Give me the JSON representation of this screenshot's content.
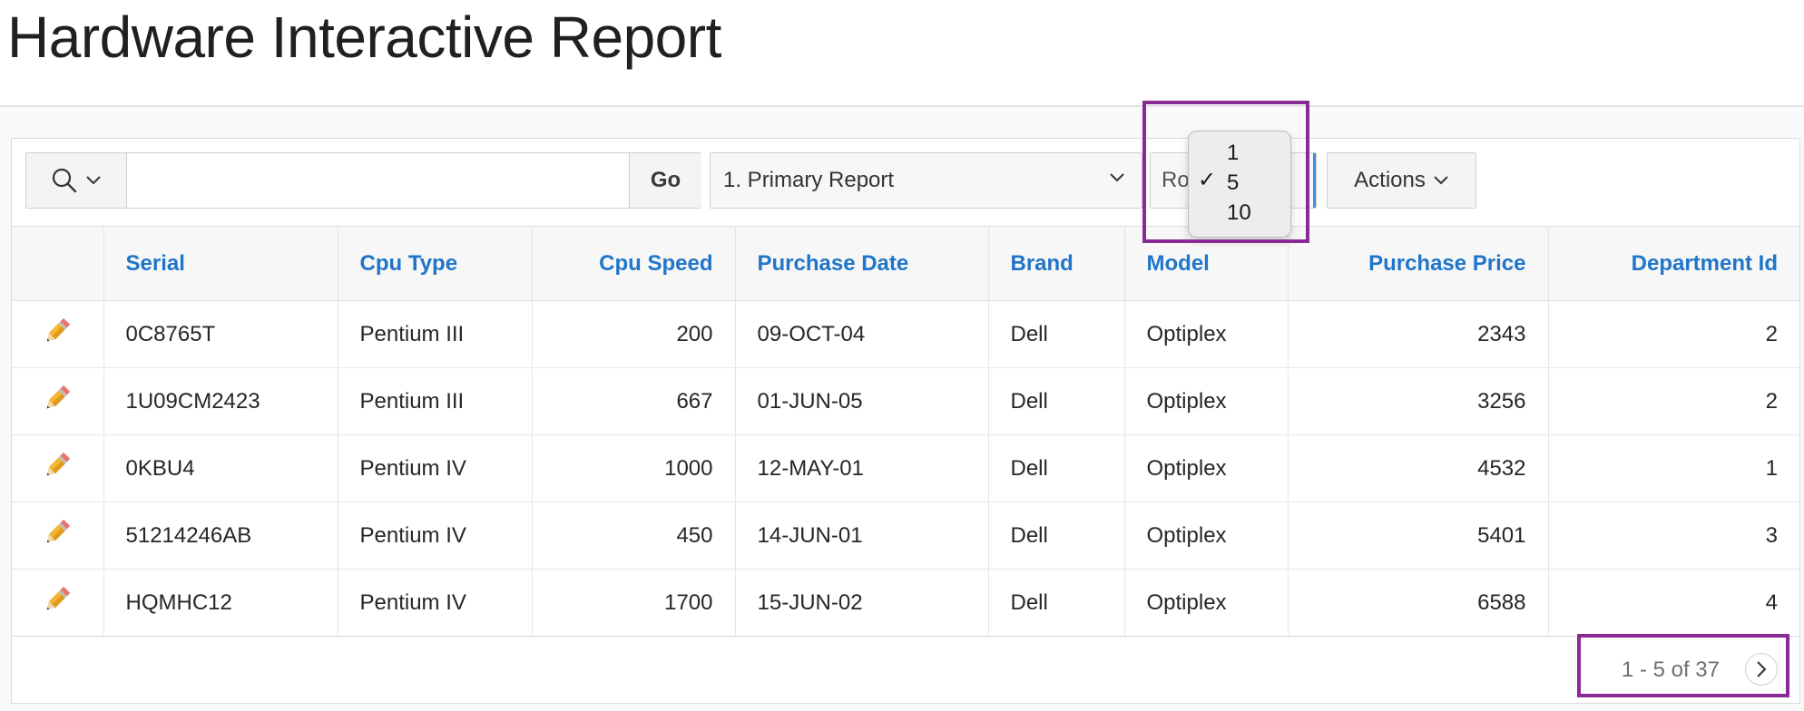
{
  "page": {
    "title": "Hardware Interactive Report"
  },
  "toolbar": {
    "search_value": "",
    "go_label": "Go",
    "report_select": "1. Primary Report",
    "rows_label": "Rows",
    "actions_label": "Actions"
  },
  "rows_dropdown": {
    "options": [
      "1",
      "5",
      "10"
    ],
    "selected": "5",
    "check_glyph": "✓"
  },
  "table": {
    "columns": [
      "Serial",
      "Cpu Type",
      "Cpu Speed",
      "Purchase Date",
      "Brand",
      "Model",
      "Purchase Price",
      "Department Id"
    ],
    "rows": [
      [
        "0C8765T",
        "Pentium III",
        "200",
        "09-OCT-04",
        "Dell",
        "Optiplex",
        "2343",
        "2"
      ],
      [
        "1U09CM2423",
        "Pentium III",
        "667",
        "01-JUN-05",
        "Dell",
        "Optiplex",
        "3256",
        "2"
      ],
      [
        "0KBU4",
        "Pentium IV",
        "1000",
        "12-MAY-01",
        "Dell",
        "Optiplex",
        "4532",
        "1"
      ],
      [
        "51214246AB",
        "Pentium IV",
        "450",
        "14-JUN-01",
        "Dell",
        "Optiplex",
        "5401",
        "3"
      ],
      [
        "HQMHC12",
        "Pentium IV",
        "1700",
        "15-JUN-02",
        "Dell",
        "Optiplex",
        "6588",
        "4"
      ]
    ]
  },
  "pagination": {
    "text": "1 - 5 of 37"
  },
  "colors": {
    "header_link": "#1f75c9",
    "highlight": "#8a2a96",
    "focus": "#3d8fe0"
  },
  "icons": [
    "search-icon",
    "chevron-down-icon",
    "pencil-icon",
    "chevron-right-icon",
    "checkmark-icon"
  ]
}
